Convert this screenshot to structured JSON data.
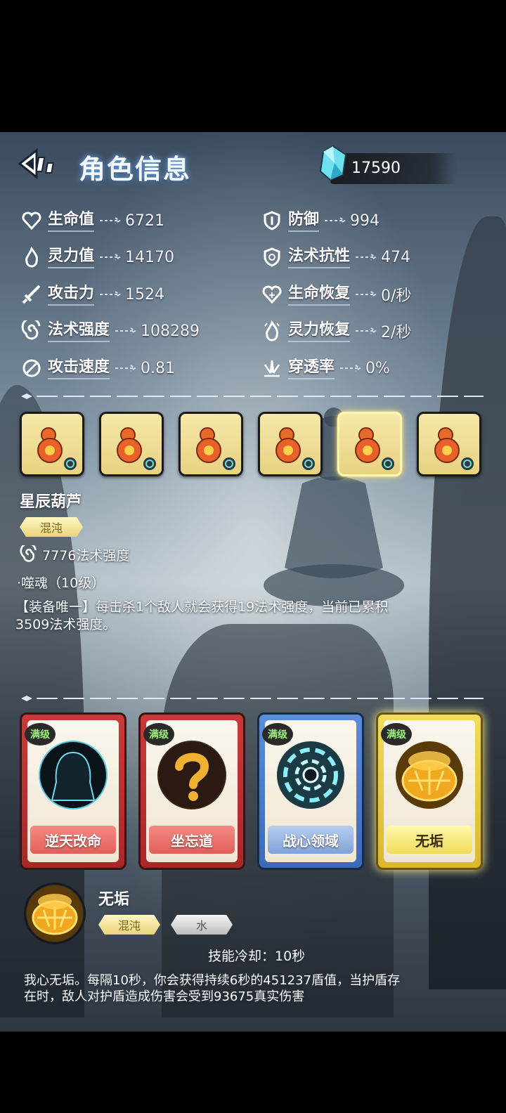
{
  "header": {
    "title": "角色信息",
    "currency_amount": "17590"
  },
  "stats_left": [
    {
      "icon": "heart-icon",
      "label": "生命值",
      "value": "6721"
    },
    {
      "icon": "flame-icon",
      "label": "灵力值",
      "value": "14170"
    },
    {
      "icon": "sword-icon",
      "label": "攻击力",
      "value": "1524"
    },
    {
      "icon": "swirl-icon",
      "label": "法术强度",
      "value": "108289"
    },
    {
      "icon": "speed-icon",
      "label": "攻击速度",
      "value": "0.81"
    }
  ],
  "stats_right": [
    {
      "icon": "shield-icon",
      "label": "防御",
      "value": "994"
    },
    {
      "icon": "magic-shield-icon",
      "label": "法术抗性",
      "value": "474"
    },
    {
      "icon": "heart-regen-icon",
      "label": "生命恢复",
      "value": "0/秒"
    },
    {
      "icon": "flame-regen-icon",
      "label": "灵力恢复",
      "value": "2/秒"
    },
    {
      "icon": "pierce-icon",
      "label": "穿透率",
      "value": "0%"
    }
  ],
  "equipment": {
    "slots": 6,
    "selected_index": 4,
    "item": {
      "name": "星辰葫芦",
      "element_tag": "混沌",
      "bonus": "7776法术强度",
      "passive_name": "·噬魂（10级）",
      "passive_desc_line1": "【装备唯一】每击杀1个敌人就会获得19法术强度，当前已累积",
      "passive_desc_line2": "3509法术强度。"
    }
  },
  "skills": {
    "level_badge": "满级",
    "cards": [
      {
        "name": "逆天改命",
        "theme": "red"
      },
      {
        "name": "坐忘道",
        "theme": "red"
      },
      {
        "name": "战心领域",
        "theme": "blue"
      },
      {
        "name": "无垢",
        "theme": "gold"
      }
    ],
    "selected": {
      "name": "无垢",
      "tag1": "混沌",
      "tag2": "水",
      "cooldown": "技能冷却：10秒",
      "desc_line1": "我心无垢。每隔10秒，你会获得持续6秒的451237盾值，当护盾存",
      "desc_line2": "在时，敌人对护盾造成伤害会受到93675真实伤害"
    }
  }
}
